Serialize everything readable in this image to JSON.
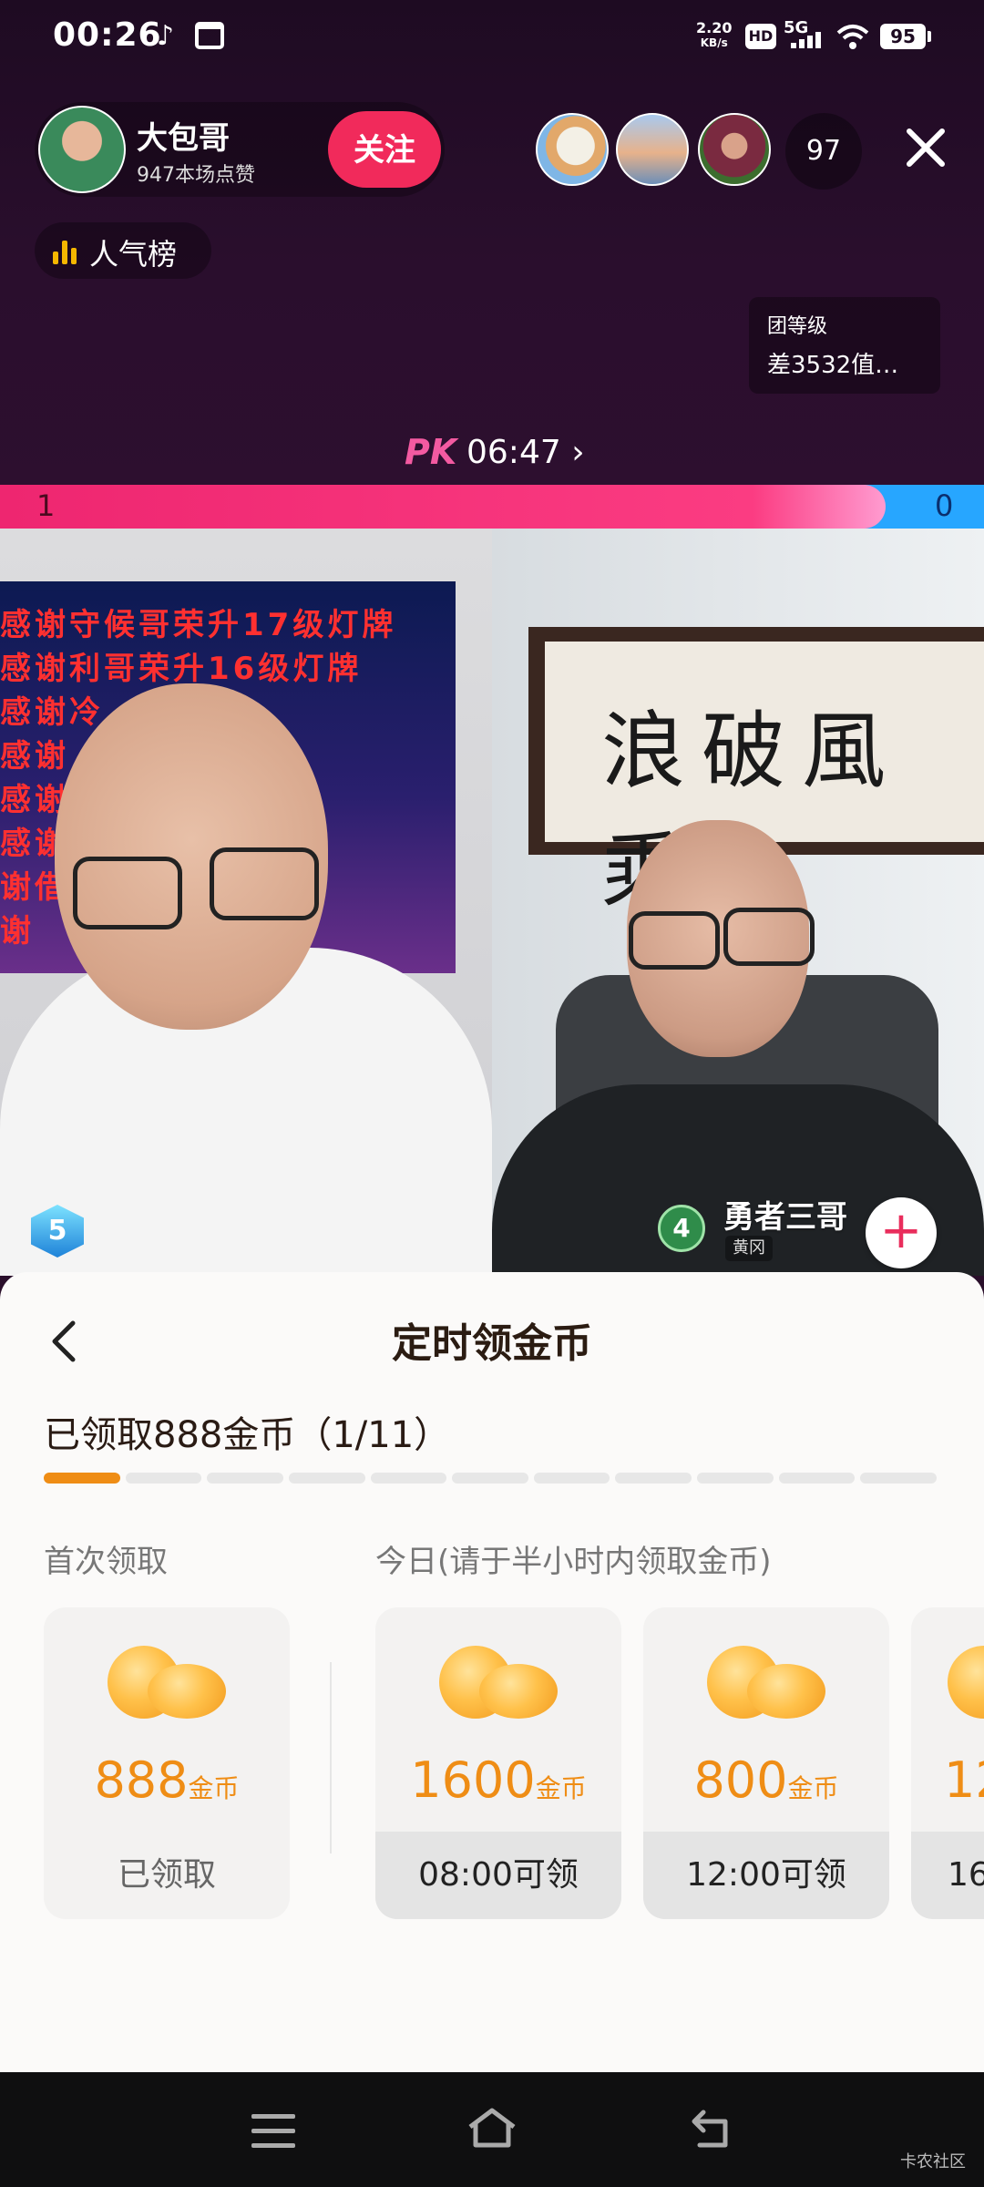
{
  "status_bar": {
    "time": "00:26",
    "net_speed_value": "2.20",
    "net_speed_unit": "KB/s",
    "hd": "HD",
    "network": "5G",
    "battery": "95"
  },
  "host": {
    "name": "大包哥",
    "likes": "947本场点赞",
    "follow_label": "关注"
  },
  "viewers": {
    "count": "97"
  },
  "popular": {
    "label": "人气榜"
  },
  "team": {
    "title": "团等级",
    "subtitle": "差3532值…"
  },
  "pk": {
    "logo": "PK",
    "timer": "06:47",
    "left_score": "1",
    "right_score": "0",
    "left_ratio": 0.9
  },
  "left_video": {
    "banner_lines": [
      "感谢守候哥荣升17级灯牌",
      "感谢利哥荣升16级灯牌",
      "感谢冷",
      "感谢",
      "感谢",
      "感谢",
      "谢借",
      "谢"
    ],
    "level": "5"
  },
  "right_video": {
    "calligraphy": "浪破風乘",
    "level": "4",
    "name": "勇者三哥",
    "tag": "黄冈"
  },
  "sheet": {
    "title": "定时领金币",
    "claimed_text": "已领取888金币（1/11）",
    "progress_total": 11,
    "progress_done": 1,
    "label_first": "首次领取",
    "label_today": "今日(请于半小时内领取金币)",
    "cards": [
      {
        "amount": "888",
        "unit": "金币",
        "foot": "已领取",
        "state": "claimed"
      },
      {
        "amount": "1600",
        "unit": "金币",
        "foot": "08:00可领",
        "state": "pending"
      },
      {
        "amount": "800",
        "unit": "金币",
        "foot": "12:00可领",
        "state": "pending"
      },
      {
        "amount": "12",
        "unit": "",
        "foot": "16",
        "state": "pending"
      }
    ]
  },
  "watermark": "卡农社区",
  "colors": {
    "accent_pink": "#f12a5b",
    "coin_orange": "#ef8d15",
    "pk_blue": "#27a6ff"
  }
}
